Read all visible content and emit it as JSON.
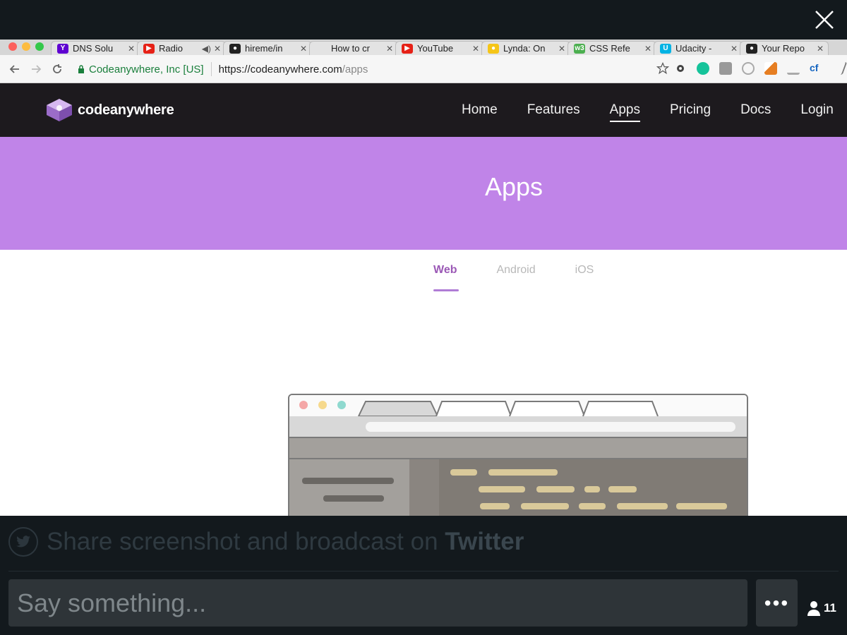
{
  "overlay": {
    "share_text": "Share screenshot and broadcast on ",
    "share_brand": "Twitter",
    "say_placeholder": "Say something...",
    "more_label": "•••",
    "viewer_count": "11"
  },
  "browser": {
    "tabs": [
      {
        "title": "DNS Solu",
        "icon": "yahoo-icon",
        "color": "#5f01d1",
        "glyph": "Y"
      },
      {
        "title": "Radio",
        "icon": "youtube-icon",
        "color": "#e62117",
        "glyph": "▶",
        "audio": "◀)"
      },
      {
        "title": "hireme/in",
        "icon": "github-icon",
        "color": "#222222",
        "glyph": "●"
      },
      {
        "title": "How to cr",
        "icon": "page-icon",
        "color": "#e3e3e3",
        "glyph": ""
      },
      {
        "title": "YouTube",
        "icon": "youtube-icon",
        "color": "#e62117",
        "glyph": "▶"
      },
      {
        "title": "Lynda: On",
        "icon": "lynda-icon",
        "color": "#f5c518",
        "glyph": "●"
      },
      {
        "title": "CSS Refe",
        "icon": "w3-icon",
        "color": "#4caf50",
        "glyph": "w3"
      },
      {
        "title": "Udacity -",
        "icon": "udacity-icon",
        "color": "#02b3e4",
        "glyph": "U"
      },
      {
        "title": "Your Repo",
        "icon": "github-icon",
        "color": "#222222",
        "glyph": "●"
      }
    ],
    "secure_label": "Codeanywhere, Inc [US]",
    "url_host": "https://codeanywhere.com",
    "url_path": "/apps"
  },
  "site": {
    "brand": "codeanywhere",
    "nav": [
      "Home",
      "Features",
      "Apps",
      "Pricing",
      "Docs",
      "Login"
    ],
    "active_nav": "Apps",
    "hero_title": "Apps",
    "platform_tabs": [
      "Web",
      "Android",
      "iOS"
    ],
    "active_platform": "Web"
  },
  "colors": {
    "hero": "#c084e8",
    "accent": "#9b59b6",
    "header": "#1d1a1e"
  }
}
